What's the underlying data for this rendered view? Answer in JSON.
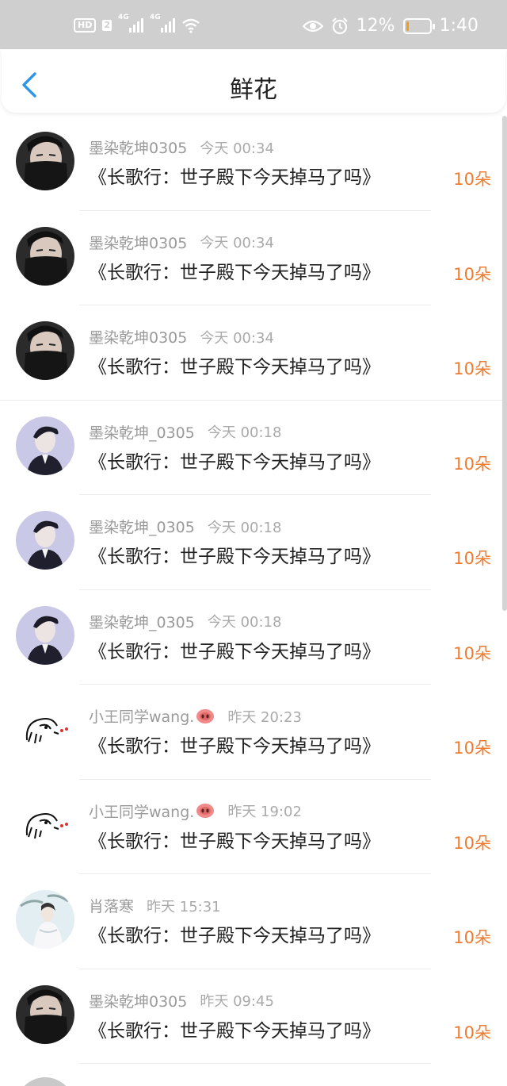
{
  "status_bar": {
    "hd_label": "HD",
    "sim_label": "2",
    "signal1_label": "4G",
    "signal2_label": "4G",
    "battery_percent": "12%",
    "battery_level": 0.12,
    "time": "1:40",
    "icons": [
      "eye-icon",
      "alarm-icon",
      "wifi-icon",
      "battery-icon"
    ]
  },
  "header": {
    "title": "鲜花",
    "back_icon": "chevron-left-icon",
    "accent": "#2f95e8"
  },
  "colors": {
    "count": "#f07a2e",
    "meta": "#9a9a9a"
  },
  "items": [
    {
      "user": "墨染乾坤0305",
      "time": "今天 00:34",
      "book": "《长歌行：世子殿下今天掉马了吗》",
      "count": "10朵",
      "avatar": "masked-man"
    },
    {
      "user": "墨染乾坤0305",
      "time": "今天 00:34",
      "book": "《长歌行：世子殿下今天掉马了吗》",
      "count": "10朵",
      "avatar": "masked-man"
    },
    {
      "user": "墨染乾坤0305",
      "time": "今天 00:34",
      "book": "《长歌行：世子殿下今天掉马了吗》",
      "count": "10朵",
      "avatar": "masked-man"
    },
    {
      "user": "墨染乾坤_0305",
      "time": "今天 00:18",
      "book": "《长歌行：世子殿下今天掉马了吗》",
      "count": "10朵",
      "avatar": "suit-man"
    },
    {
      "user": "墨染乾坤_0305",
      "time": "今天 00:18",
      "book": "《长歌行：世子殿下今天掉马了吗》",
      "count": "10朵",
      "avatar": "suit-man"
    },
    {
      "user": "墨染乾坤_0305",
      "time": "今天 00:18",
      "book": "《长歌行：世子殿下今天掉马了吗》",
      "count": "10朵",
      "avatar": "suit-man"
    },
    {
      "user": "小王同学wang.",
      "time": "昨天 20:23",
      "book": "《长歌行：世子殿下今天掉马了吗》",
      "count": "10朵",
      "avatar": "sketch"
    },
    {
      "user": "小王同学wang.",
      "time": "昨天 19:02",
      "book": "《长歌行：世子殿下今天掉马了吗》",
      "count": "10朵",
      "avatar": "sketch"
    },
    {
      "user": "肖落寒",
      "time": "昨天 15:31",
      "book": "《长歌行：世子殿下今天掉马了吗》",
      "count": "10朵",
      "avatar": "ancient"
    },
    {
      "user": "墨染乾坤0305",
      "time": "昨天 09:45",
      "book": "《长歌行：世子殿下今天掉马了吗》",
      "count": "10朵",
      "avatar": "masked-man"
    }
  ]
}
